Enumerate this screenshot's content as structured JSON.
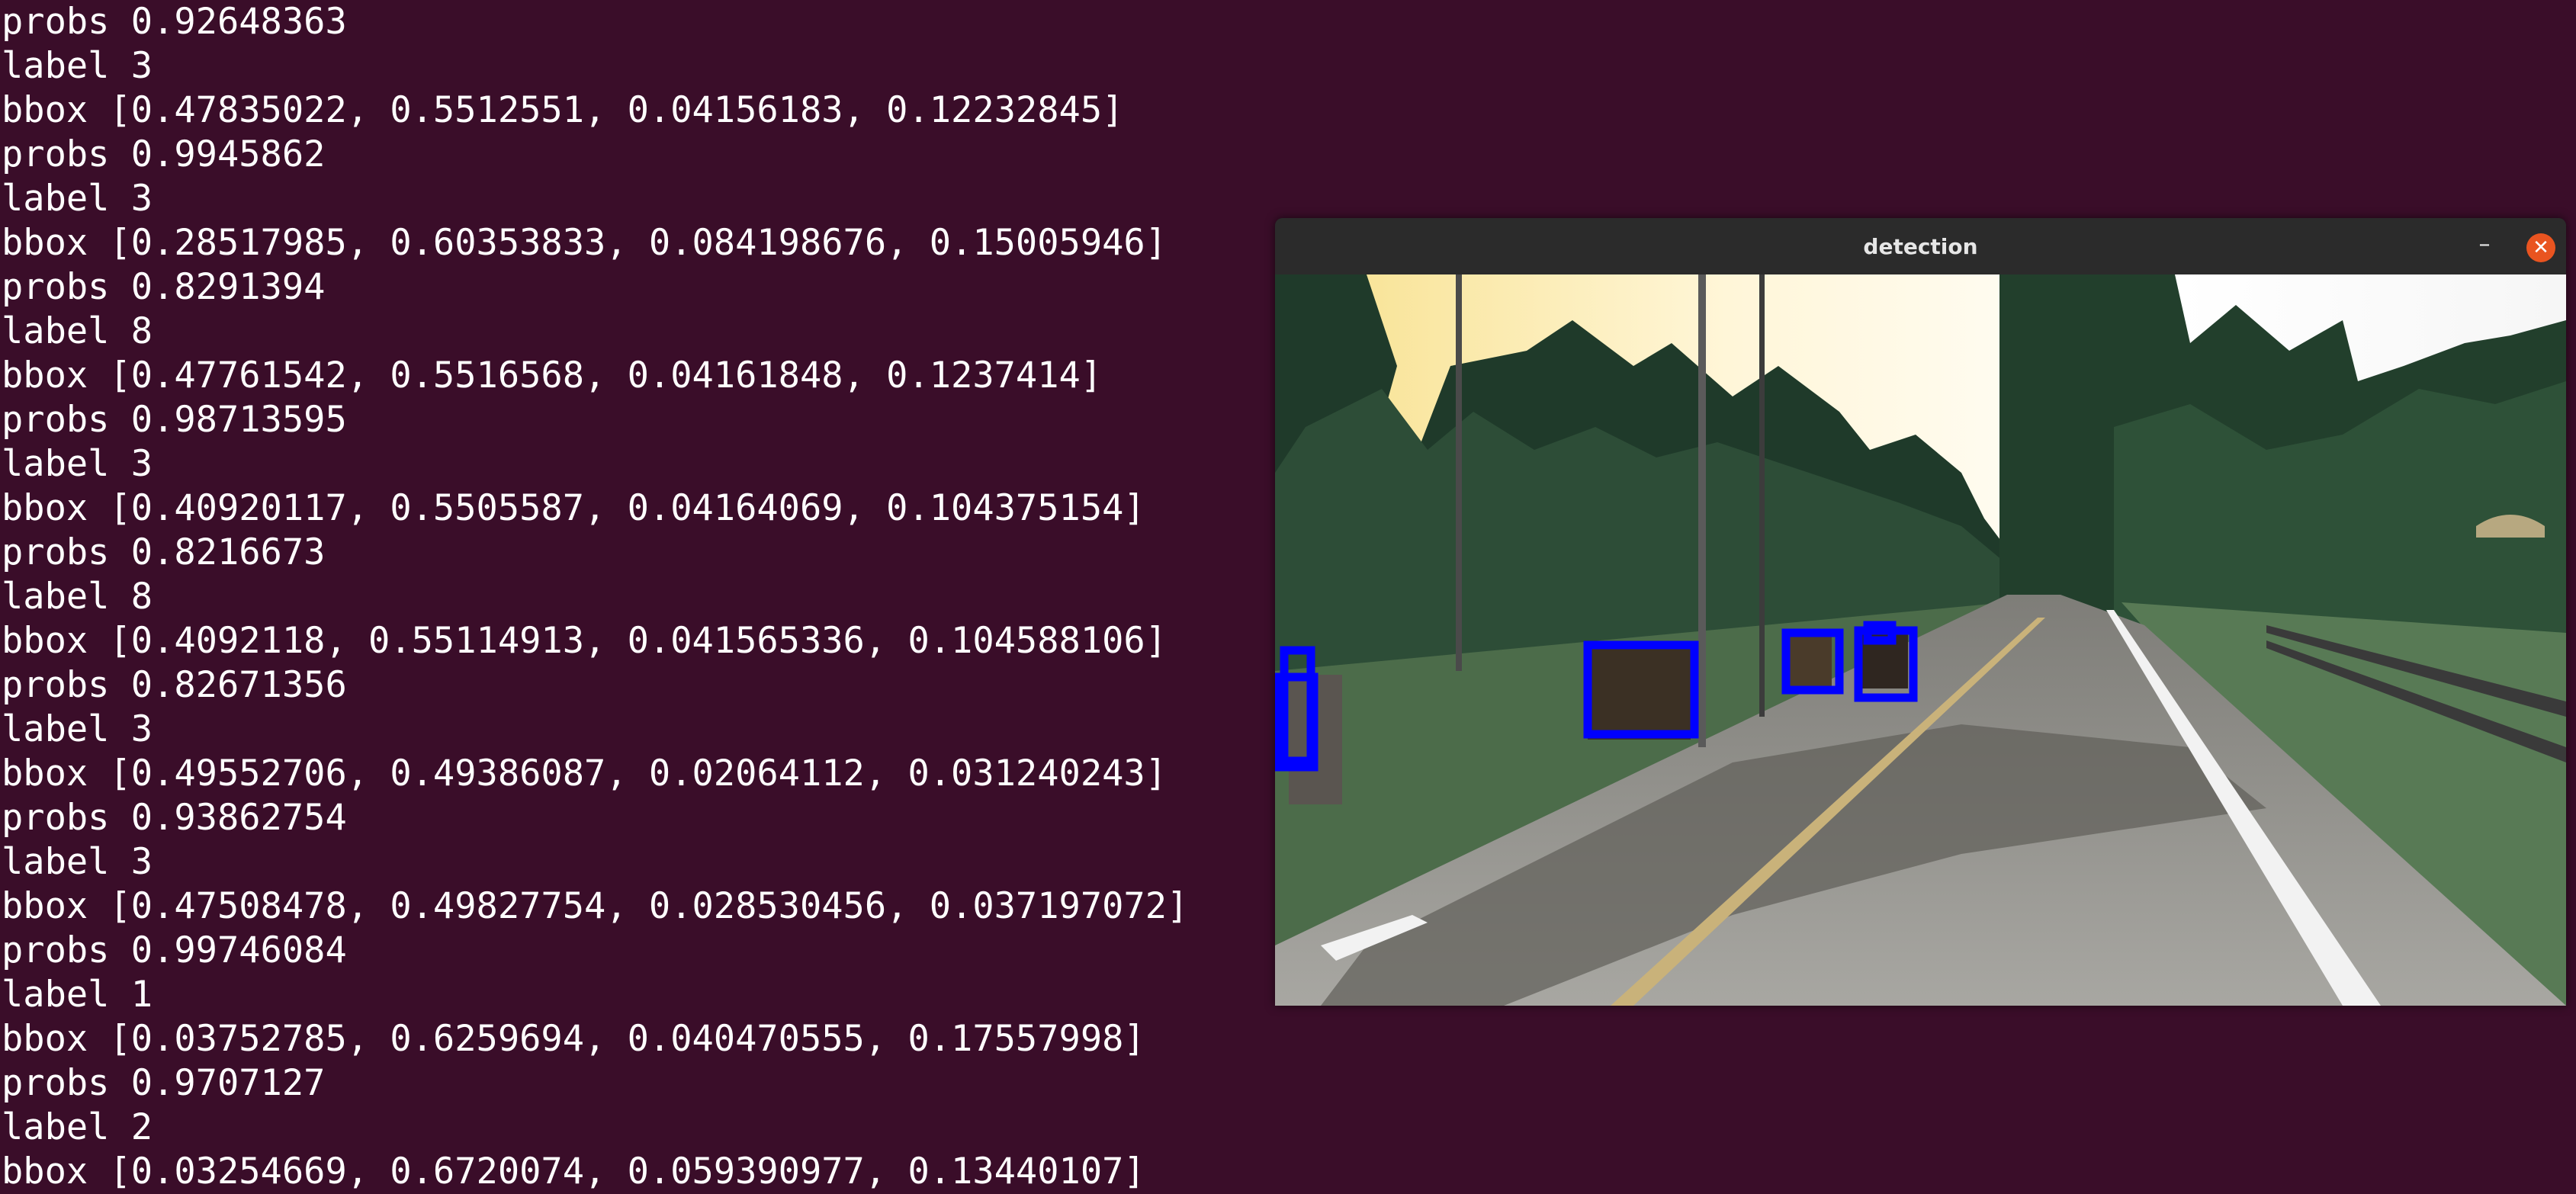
{
  "terminal": {
    "lines": [
      "probs 0.92648363",
      "label 3",
      "bbox [0.47835022, 0.5512551, 0.04156183, 0.12232845]",
      "probs 0.9945862",
      "label 3",
      "bbox [0.28517985, 0.60353833, 0.084198676, 0.15005946]",
      "probs 0.8291394",
      "label 8",
      "bbox [0.47761542, 0.5516568, 0.04161848, 0.1237414]",
      "probs 0.98713595",
      "label 3",
      "bbox [0.40920117, 0.5505587, 0.04164069, 0.104375154]",
      "probs 0.8216673",
      "label 8",
      "bbox [0.4092118, 0.55114913, 0.041565336, 0.104588106]",
      "probs 0.82671356",
      "label 3",
      "bbox [0.49552706, 0.49386087, 0.02064112, 0.031240243]",
      "probs 0.93862754",
      "label 3",
      "bbox [0.47508478, 0.49827754, 0.028530456, 0.037197072]",
      "probs 0.99746084",
      "label 1",
      "bbox [0.03752785, 0.6259694, 0.040470555, 0.17557998]",
      "probs 0.9707127",
      "label 2",
      "bbox [0.03254669, 0.6720074, 0.059390977, 0.13440107]"
    ]
  },
  "window": {
    "title": "detection",
    "minimize_icon": "minimize-icon",
    "close_icon": "close-icon"
  },
  "colors": {
    "terminal_bg": "#3a0d29",
    "terminal_text": "#ffffff",
    "box_color": "#0000ff",
    "close_accent": "#e95420"
  }
}
